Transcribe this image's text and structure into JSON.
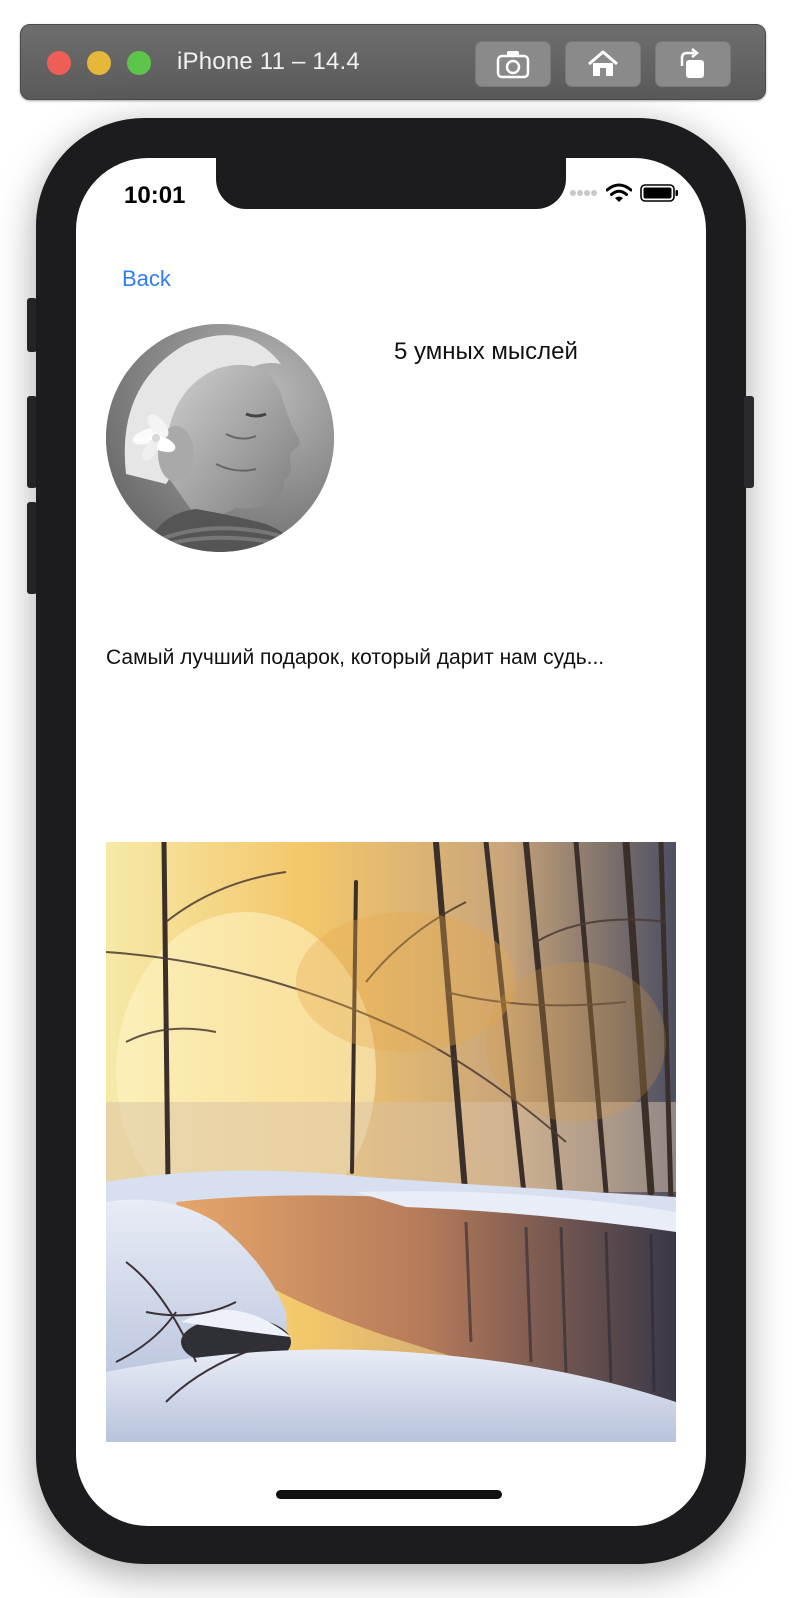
{
  "simulator": {
    "title": "iPhone 11 – 14.4",
    "toolbar_icons": [
      "screenshot-icon",
      "home-icon",
      "rotate-icon"
    ]
  },
  "status_bar": {
    "time": "10:01"
  },
  "nav": {
    "back_label": "Back"
  },
  "content": {
    "headline": "5 умных мыслей",
    "quote": "Самый лучший подарок, который дарит нам судь..."
  },
  "colors": {
    "accent": "#2f7cf6",
    "device": "#1c1c1e"
  }
}
